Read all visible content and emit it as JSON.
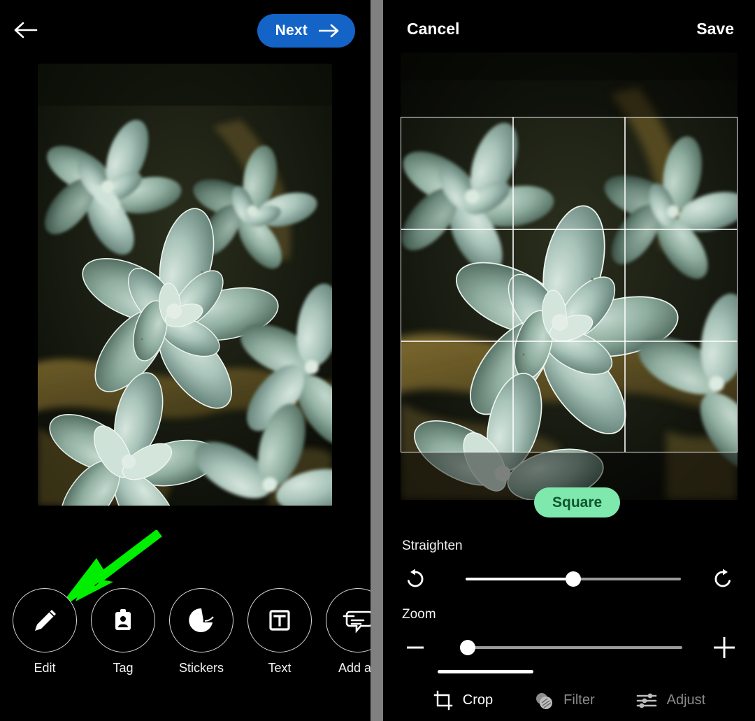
{
  "left_panel": {
    "back_icon": "arrow-left-icon",
    "next_button": {
      "label": "Next",
      "icon": "arrow-right-icon",
      "color": "#1464c8"
    },
    "photo": {
      "alt": "Close-up photo of pale green succulent rosettes",
      "is_cropped_preview": false
    },
    "annotation": {
      "type": "arrow",
      "color": "#00ee00",
      "points_to": "Edit"
    },
    "toolbar": [
      {
        "label": "Edit",
        "icon": "pencil-icon"
      },
      {
        "label": "Tag",
        "icon": "person-badge-icon"
      },
      {
        "label": "Stickers",
        "icon": "sticker-peel-icon"
      },
      {
        "label": "Text",
        "icon": "text-box-icon"
      },
      {
        "label": "Add alt",
        "icon": "alt-text-bubble-icon"
      }
    ]
  },
  "right_panel": {
    "header": {
      "cancel_label": "Cancel",
      "save_label": "Save"
    },
    "photo": {
      "alt": "Close-up photo of pale green succulent rosettes"
    },
    "crop": {
      "grid_lines": 2,
      "aspect_pill": {
        "label": "Square",
        "background": "#7fe9ad",
        "text_color": "#11552f"
      }
    },
    "straighten": {
      "title": "Straighten",
      "rotate_left_icon": "rotate-left-icon",
      "rotate_right_icon": "rotate-right-icon",
      "value_percent": 50
    },
    "zoom": {
      "title": "Zoom",
      "minus_icon": "minus-icon",
      "plus_icon": "plus-icon",
      "value_percent": 1
    },
    "tabs": [
      {
        "label": "Crop",
        "icon": "crop-icon",
        "active": true
      },
      {
        "label": "Filter",
        "icon": "filter-icon",
        "active": false
      },
      {
        "label": "Adjust",
        "icon": "sliders-icon",
        "active": false
      }
    ]
  },
  "divider": {
    "color": "#808080"
  }
}
